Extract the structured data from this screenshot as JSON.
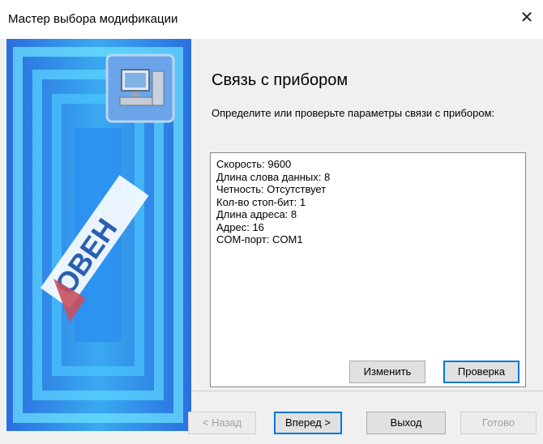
{
  "window": {
    "title": "Мастер выбора модификации",
    "close_label": "✕"
  },
  "page": {
    "heading": "Связь с прибором",
    "description": "Определите или проверьте параметры связи с прибором:"
  },
  "connection_params": [
    "Скорость: 9600",
    "Длина слова данных: 8",
    "Четность: Отсутствует",
    "Кол-во стоп-бит: 1",
    "Длина адреса: 8",
    "Адрес: 16",
    "COM-порт: COM1"
  ],
  "buttons": {
    "change": "Изменить",
    "check": "Проверка",
    "back": "< Назад",
    "next": "Вперед >",
    "exit": "Выход",
    "finish": "Готово"
  },
  "banner": {
    "logo_text": "ОВЕН"
  },
  "colors": {
    "accent": "#0078d7",
    "banner_blue": "#2b7fe3",
    "banner_cyan": "#38d9f5"
  }
}
